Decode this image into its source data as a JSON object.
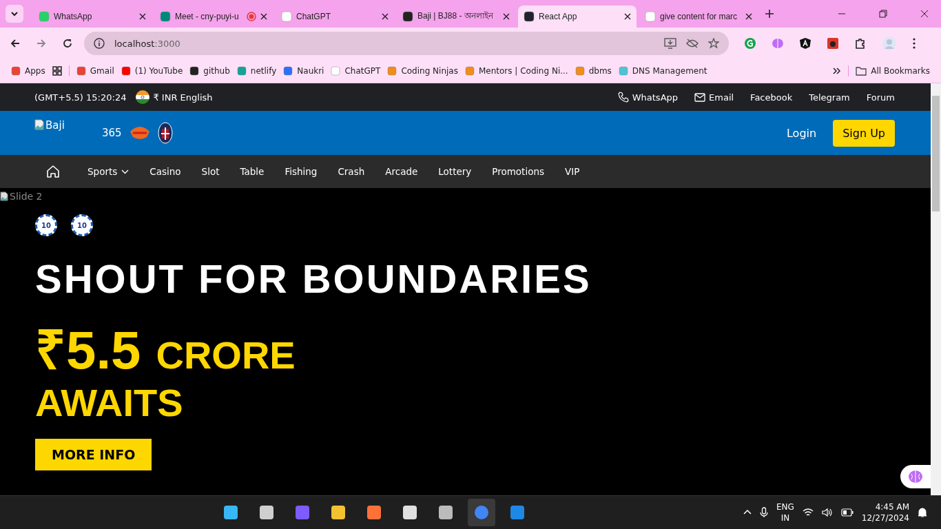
{
  "browser": {
    "tabs": [
      {
        "title": "WhatsApp",
        "selected": false,
        "recording": false
      },
      {
        "title": "Meet - cny-puyi-u",
        "selected": false,
        "recording": true
      },
      {
        "title": "ChatGPT",
        "selected": false,
        "recording": false
      },
      {
        "title": "Baji | BJ88 - অনলাইন",
        "selected": false,
        "recording": false
      },
      {
        "title": "React App",
        "selected": true,
        "recording": false
      },
      {
        "title": "give content for marc",
        "selected": false,
        "recording": false
      }
    ],
    "address": {
      "host": "localhost",
      "port": ":3000"
    },
    "bookmarks": [
      "Apps",
      "Gmail",
      "(1) YouTube",
      "github",
      "netlify",
      "Naukri",
      "ChatGPT",
      "Coding Ninjas",
      "Mentors | Coding Ni...",
      "dbms",
      "DNS Management"
    ],
    "all_bookmarks": "All Bookmarks"
  },
  "site": {
    "topbar": {
      "time": "(GMT+5.5) 15:20:24",
      "currency": "₹ INR English",
      "links": [
        {
          "label": "WhatsApp",
          "kind": "phone"
        },
        {
          "label": "Email",
          "kind": "mail"
        },
        {
          "label": "Facebook",
          "kind": "plain"
        },
        {
          "label": "Telegram",
          "kind": "plain"
        },
        {
          "label": "Forum",
          "kind": "plain"
        }
      ]
    },
    "header": {
      "logo_alt": "Baji",
      "sponsor": "365",
      "login": "Login",
      "signup": "Sign Up"
    },
    "nav": [
      {
        "label": "Sports",
        "kind": "dropdown"
      },
      {
        "label": "Casino",
        "kind": "link"
      },
      {
        "label": "Slot",
        "kind": "link"
      },
      {
        "label": "Table",
        "kind": "link"
      },
      {
        "label": "Fishing",
        "kind": "link"
      },
      {
        "label": "Crash",
        "kind": "link"
      },
      {
        "label": "Arcade",
        "kind": "link"
      },
      {
        "label": "Lottery",
        "kind": "link"
      },
      {
        "label": "Promotions",
        "kind": "link"
      },
      {
        "label": "VIP",
        "kind": "link"
      }
    ],
    "hero": {
      "image_alt": "Slide 2",
      "chips": [
        "10",
        "10"
      ],
      "headline": "SHOUT FOR BOUNDARIES",
      "amount": "₹5.5",
      "unit": "CRORE",
      "tail": "AWAITS",
      "button": "MORE INFO"
    }
  },
  "taskbar": {
    "apps": [
      {
        "selected": false
      },
      {
        "selected": false
      },
      {
        "selected": false
      },
      {
        "selected": false
      },
      {
        "selected": false
      },
      {
        "selected": false
      },
      {
        "selected": false
      },
      {
        "selected": true
      },
      {
        "selected": false
      }
    ],
    "lang": "ENG",
    "region": "IN",
    "time": "4:45 AM",
    "date": "12/27/2024"
  }
}
